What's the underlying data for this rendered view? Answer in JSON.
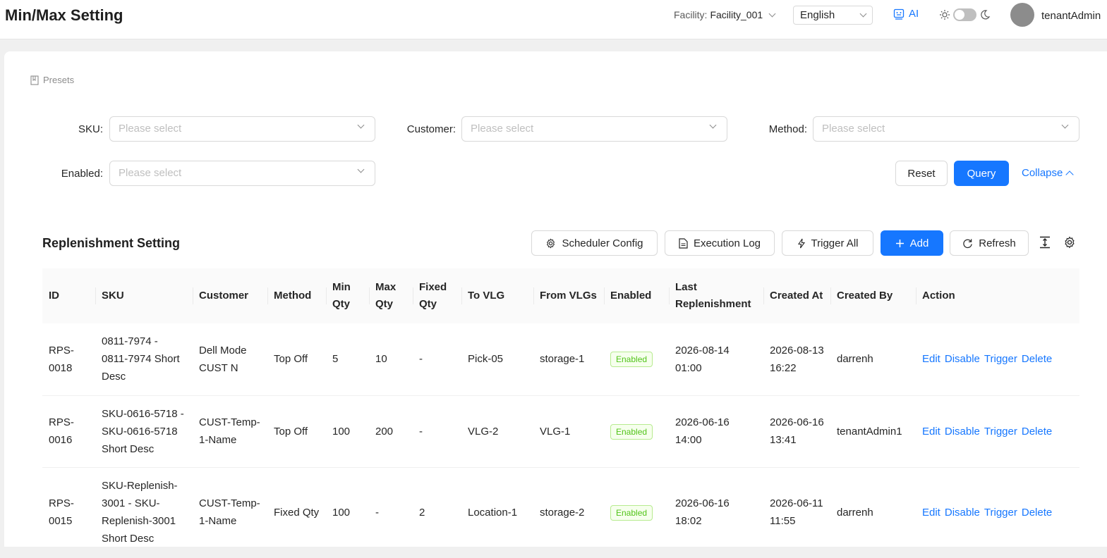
{
  "header": {
    "title": "Min/Max Setting",
    "facility_label": "Facility:",
    "facility_value": "Facility_001",
    "language": "English",
    "ai_label": "AI",
    "username": "tenantAdmin"
  },
  "filters": {
    "presets_label": "Presets",
    "sku_label": "SKU",
    "customer_label": "Customer",
    "method_label": "Method",
    "enabled_label": "Enabled",
    "placeholder": "Please select",
    "reset_label": "Reset",
    "query_label": "Query",
    "collapse_label": "Collapse"
  },
  "toolbar": {
    "section_title": "Replenishment Setting",
    "scheduler_label": "Scheduler Config",
    "exec_log_label": "Execution Log",
    "trigger_all_label": "Trigger All",
    "add_label": "Add",
    "refresh_label": "Refresh"
  },
  "table": {
    "columns": [
      "ID",
      "SKU",
      "Customer",
      "Method",
      "Min Qty",
      "Max Qty",
      "Fixed Qty",
      "To VLG",
      "From VLGs",
      "Enabled",
      "Last Replenishment",
      "Created At",
      "Created By",
      "Action"
    ],
    "rows": [
      {
        "id": "RPS-0018",
        "sku": "0811-7974 - 0811-7974 Short Desc",
        "customer": "Dell Mode CUST N",
        "method": "Top Off",
        "min": "5",
        "max": "10",
        "fixed": "-",
        "to_vlg": "Pick-05",
        "from_vlgs": "storage-1",
        "enabled": "Enabled",
        "last": "2026-08-14 01:00",
        "created_at": "2026-08-13 16:22",
        "created_by": "darrenh"
      },
      {
        "id": "RPS-0016",
        "sku": "SKU-0616-5718 - SKU-0616-5718 Short Desc",
        "customer": "CUST-Temp-1-Name",
        "method": "Top Off",
        "min": "100",
        "max": "200",
        "fixed": "-",
        "to_vlg": "VLG-2",
        "from_vlgs": "VLG-1",
        "enabled": "Enabled",
        "last": "2026-06-16 14:00",
        "created_at": "2026-06-16 13:41",
        "created_by": "tenantAdmin1"
      },
      {
        "id": "RPS-0015",
        "sku": "SKU-Replenish-3001 - SKU-Replenish-3001 Short Desc",
        "customer": "CUST-Temp-1-Name",
        "method": "Fixed Qty",
        "min": "100",
        "max": "-",
        "fixed": "2",
        "to_vlg": "Location-1",
        "from_vlgs": "storage-2",
        "enabled": "Enabled",
        "last": "2026-06-16 18:02",
        "created_at": "2026-06-11 11:55",
        "created_by": "darrenh"
      }
    ],
    "actions": [
      "Edit",
      "Disable",
      "Trigger",
      "Delete"
    ]
  }
}
